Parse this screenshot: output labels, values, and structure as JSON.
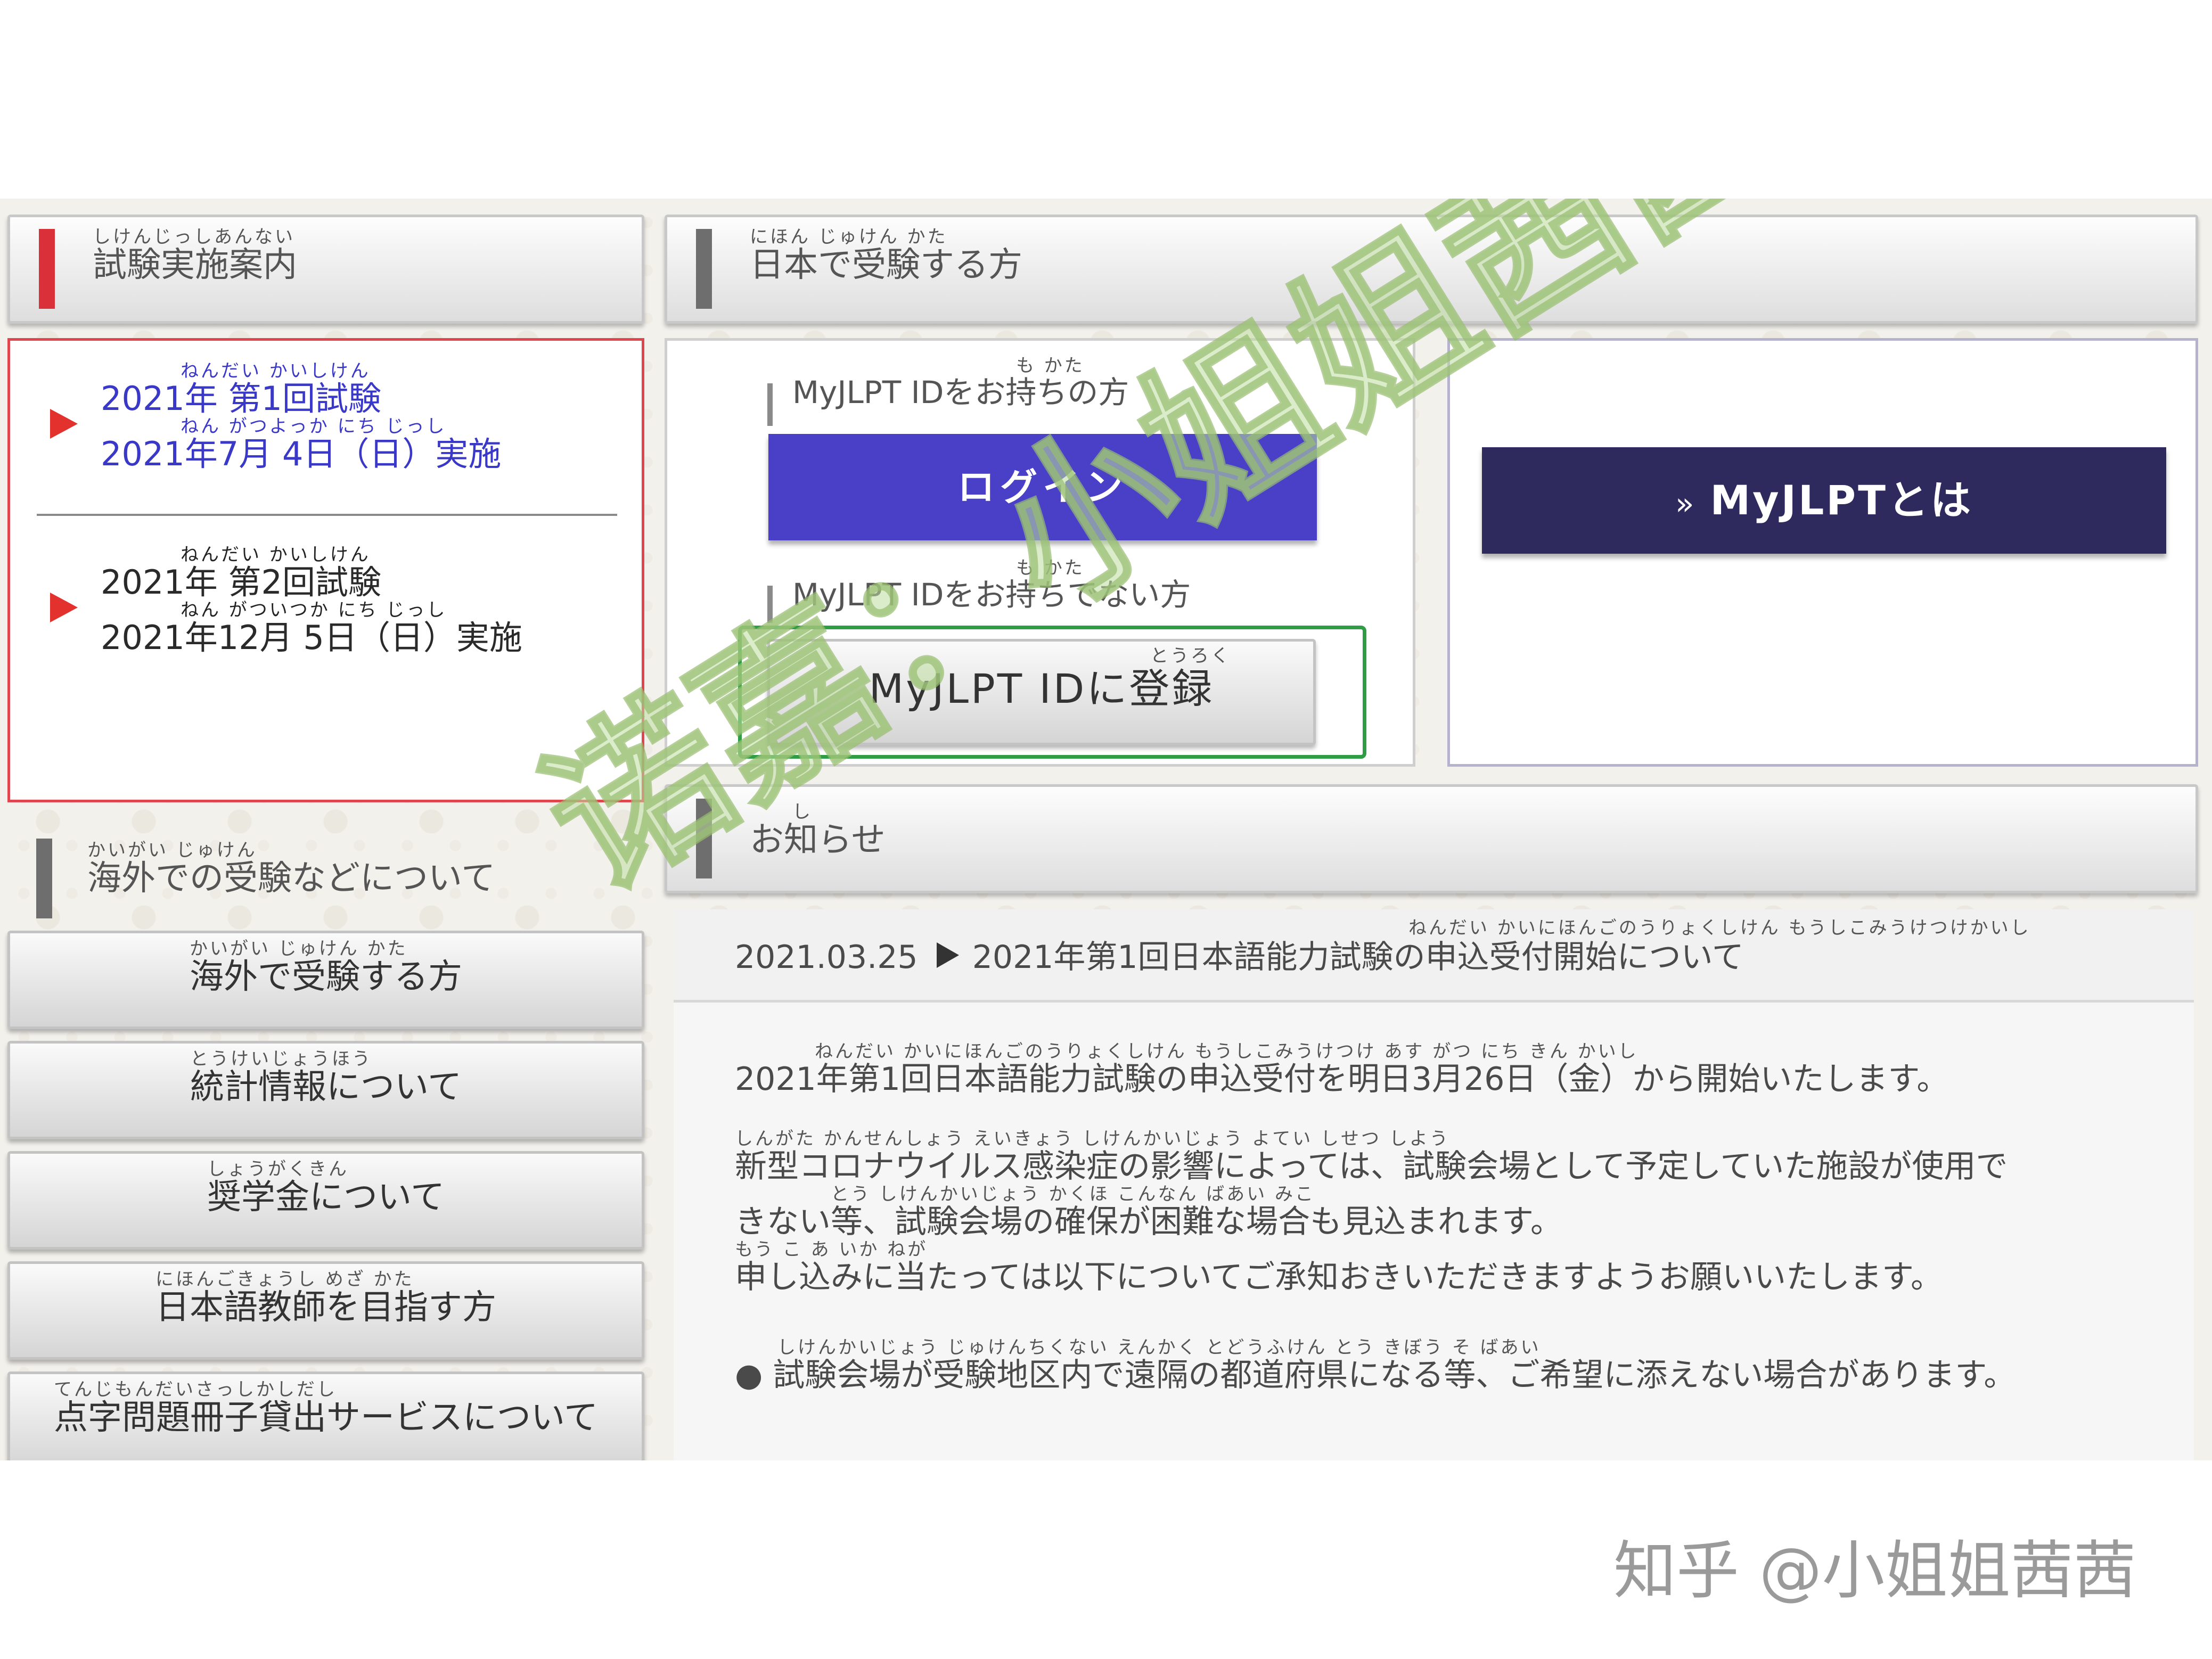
{
  "sidebar": {
    "exam_info_header": {
      "ruby": "しけんじっしあんない",
      "label": "試験実施案内"
    },
    "exams": [
      {
        "ruby1": "ねんだい かいしけん",
        "title": "2021年 第1回試験",
        "ruby2": "ねん がつよっか にち じっし",
        "date": "2021年7月 4日（日）実施"
      },
      {
        "ruby1": "ねんだい かいしけん",
        "title": "2021年 第2回試験",
        "ruby2": "ねん がついつか にち じっし",
        "date": "2021年12月 5日（日）実施"
      }
    ],
    "overseas_header": {
      "ruby": "かいがい じゅけん",
      "label": "海外での受験などについて"
    },
    "links": [
      {
        "ruby": "かいがい じゅけん かた",
        "label": "海外で受験する方"
      },
      {
        "ruby": "とうけいじょうほう",
        "label": "統計情報について"
      },
      {
        "ruby": "しょうがくきん",
        "label": "奨学金について"
      },
      {
        "ruby": "にほんごきょうし めざ かた",
        "label": "日本語教師を目指す方"
      },
      {
        "ruby": "てんじもんだいさっしかしだし",
        "label": "点字問題冊子貸出サービスについて"
      }
    ]
  },
  "main": {
    "japan_header": {
      "ruby": "にほん じゅけん かた",
      "label": "日本で受験する方"
    },
    "has_id": {
      "ruby": "も かた",
      "label": "MyJLPT IDをお持ちの方"
    },
    "login_button": "ログイン",
    "no_id": {
      "ruby": "も かた",
      "label": "MyJLPT IDをお持ちでない方"
    },
    "register_button": {
      "ruby": "とうろく",
      "label": "MyJLPT IDに登録"
    },
    "about_button": {
      "arrow": "»",
      "label": "MyJLPTとは"
    },
    "news_header": {
      "ruby": "し",
      "label": "お知らせ"
    },
    "news_item": {
      "date": "2021.03.25",
      "ruby": "ねんだい かいにほんごのうりょくしけん もうしこみうけつけかいし",
      "title": "2021年第1回日本語能力試験の申込受付開始について"
    },
    "paragraphs": [
      {
        "ruby": "ねんだい かいにほんごのうりょくしけん もうしこみうけつけ あす がつ にち きん かいし",
        "text": "2021年第1回日本語能力試験の申込受付を明日3月26日（金）から開始いたします。"
      },
      {
        "ruby": "しんがた かんせんしょう えいきょう しけんかいじょう よてい しせつ しよう",
        "text": "新型コロナウイルス感染症の影響によっては、試験会場として予定していた施設が使用で"
      },
      {
        "ruby": "とう しけんかいじょう かくほ こんなん ばあい みこ",
        "text": "きない等、試験会場の確保が困難な場合も見込まれます。"
      },
      {
        "ruby": "もう こ あ いか ねが",
        "text": "申し込みに当たっては以下についてご承知おきいただきますようお願いいたします。"
      },
      {
        "ruby": "しけんかいじょう じゅけんちくない えんかく とどうふけん とう きぼう そ ばあい",
        "text": "● 試験会場が受験地区内で遠隔の都道府県になる等、ご希望に添えない場合があります。"
      }
    ]
  },
  "overlay": {
    "watermark": "诺嘉：小姐姐茜茜",
    "footer_credit": "知乎 @小姐姐茜茜"
  },
  "colors": {
    "red_marker": "#d9303a",
    "gray_marker": "#6e6e6e",
    "login_bg": "#4a40c8",
    "about_bg": "#2e2a5e",
    "register_outline": "#2f9d45",
    "exam_link": "#3a38c6"
  }
}
